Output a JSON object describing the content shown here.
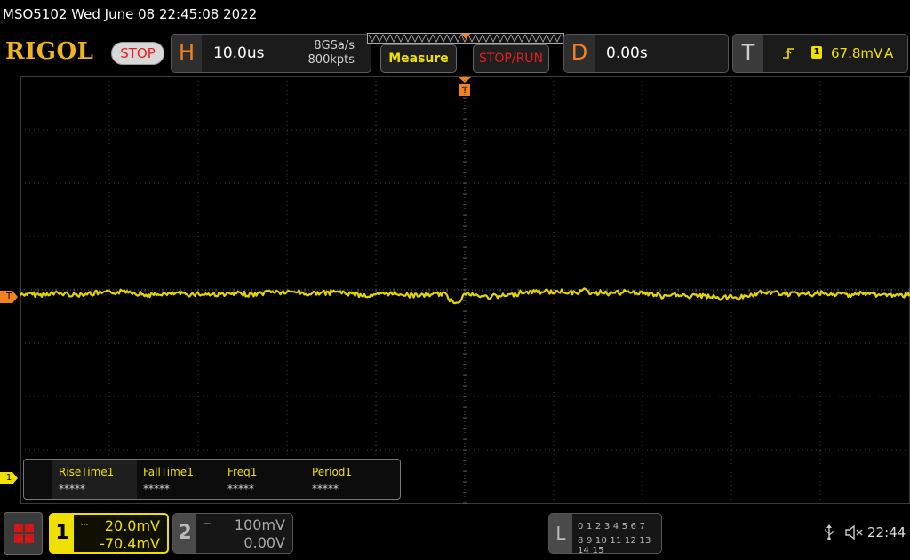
{
  "title_bar": "MSO5102  Wed June 08 22:45:08 2022",
  "header": {
    "logo": "RIGOL",
    "run_state": "STOP",
    "horizontal": {
      "letter": "H",
      "timebase": "10.0us",
      "sample_rate": "8GSa/s",
      "memory_depth": "800kpts"
    },
    "measure_button": "Measure",
    "stoprun_button": "STOP/RUN",
    "delay": {
      "letter": "D",
      "value": "0.00s"
    },
    "trigger": {
      "letter": "T",
      "source": "1",
      "level": "67.8mV",
      "mode": "A"
    }
  },
  "waveform": {
    "trigger_marker": "T",
    "ch1_marker": "1",
    "trace_color": "#f0e000",
    "trace_level_div_from_top": 4.1
  },
  "measurements": [
    {
      "label": "RiseTime1",
      "value": "*****"
    },
    {
      "label": "FallTime1",
      "value": "*****"
    },
    {
      "label": "Freq1",
      "value": "*****"
    },
    {
      "label": "Period1",
      "value": "*****"
    }
  ],
  "channels": {
    "ch1": {
      "number": "1",
      "scale": "20.0mV",
      "offset": "-70.4mV",
      "color": "#f0e000"
    },
    "ch2": {
      "number": "2",
      "scale": "100mV",
      "offset": "0.00V"
    }
  },
  "logic_analyzer": {
    "letter": "L",
    "row1": "0 1 2 3   4 5 6 7",
    "row2": "8 9 10 11  12 13 14 15"
  },
  "status": {
    "time": "22:44",
    "icons": [
      "usb-icon",
      "speaker-muted-icon"
    ]
  }
}
